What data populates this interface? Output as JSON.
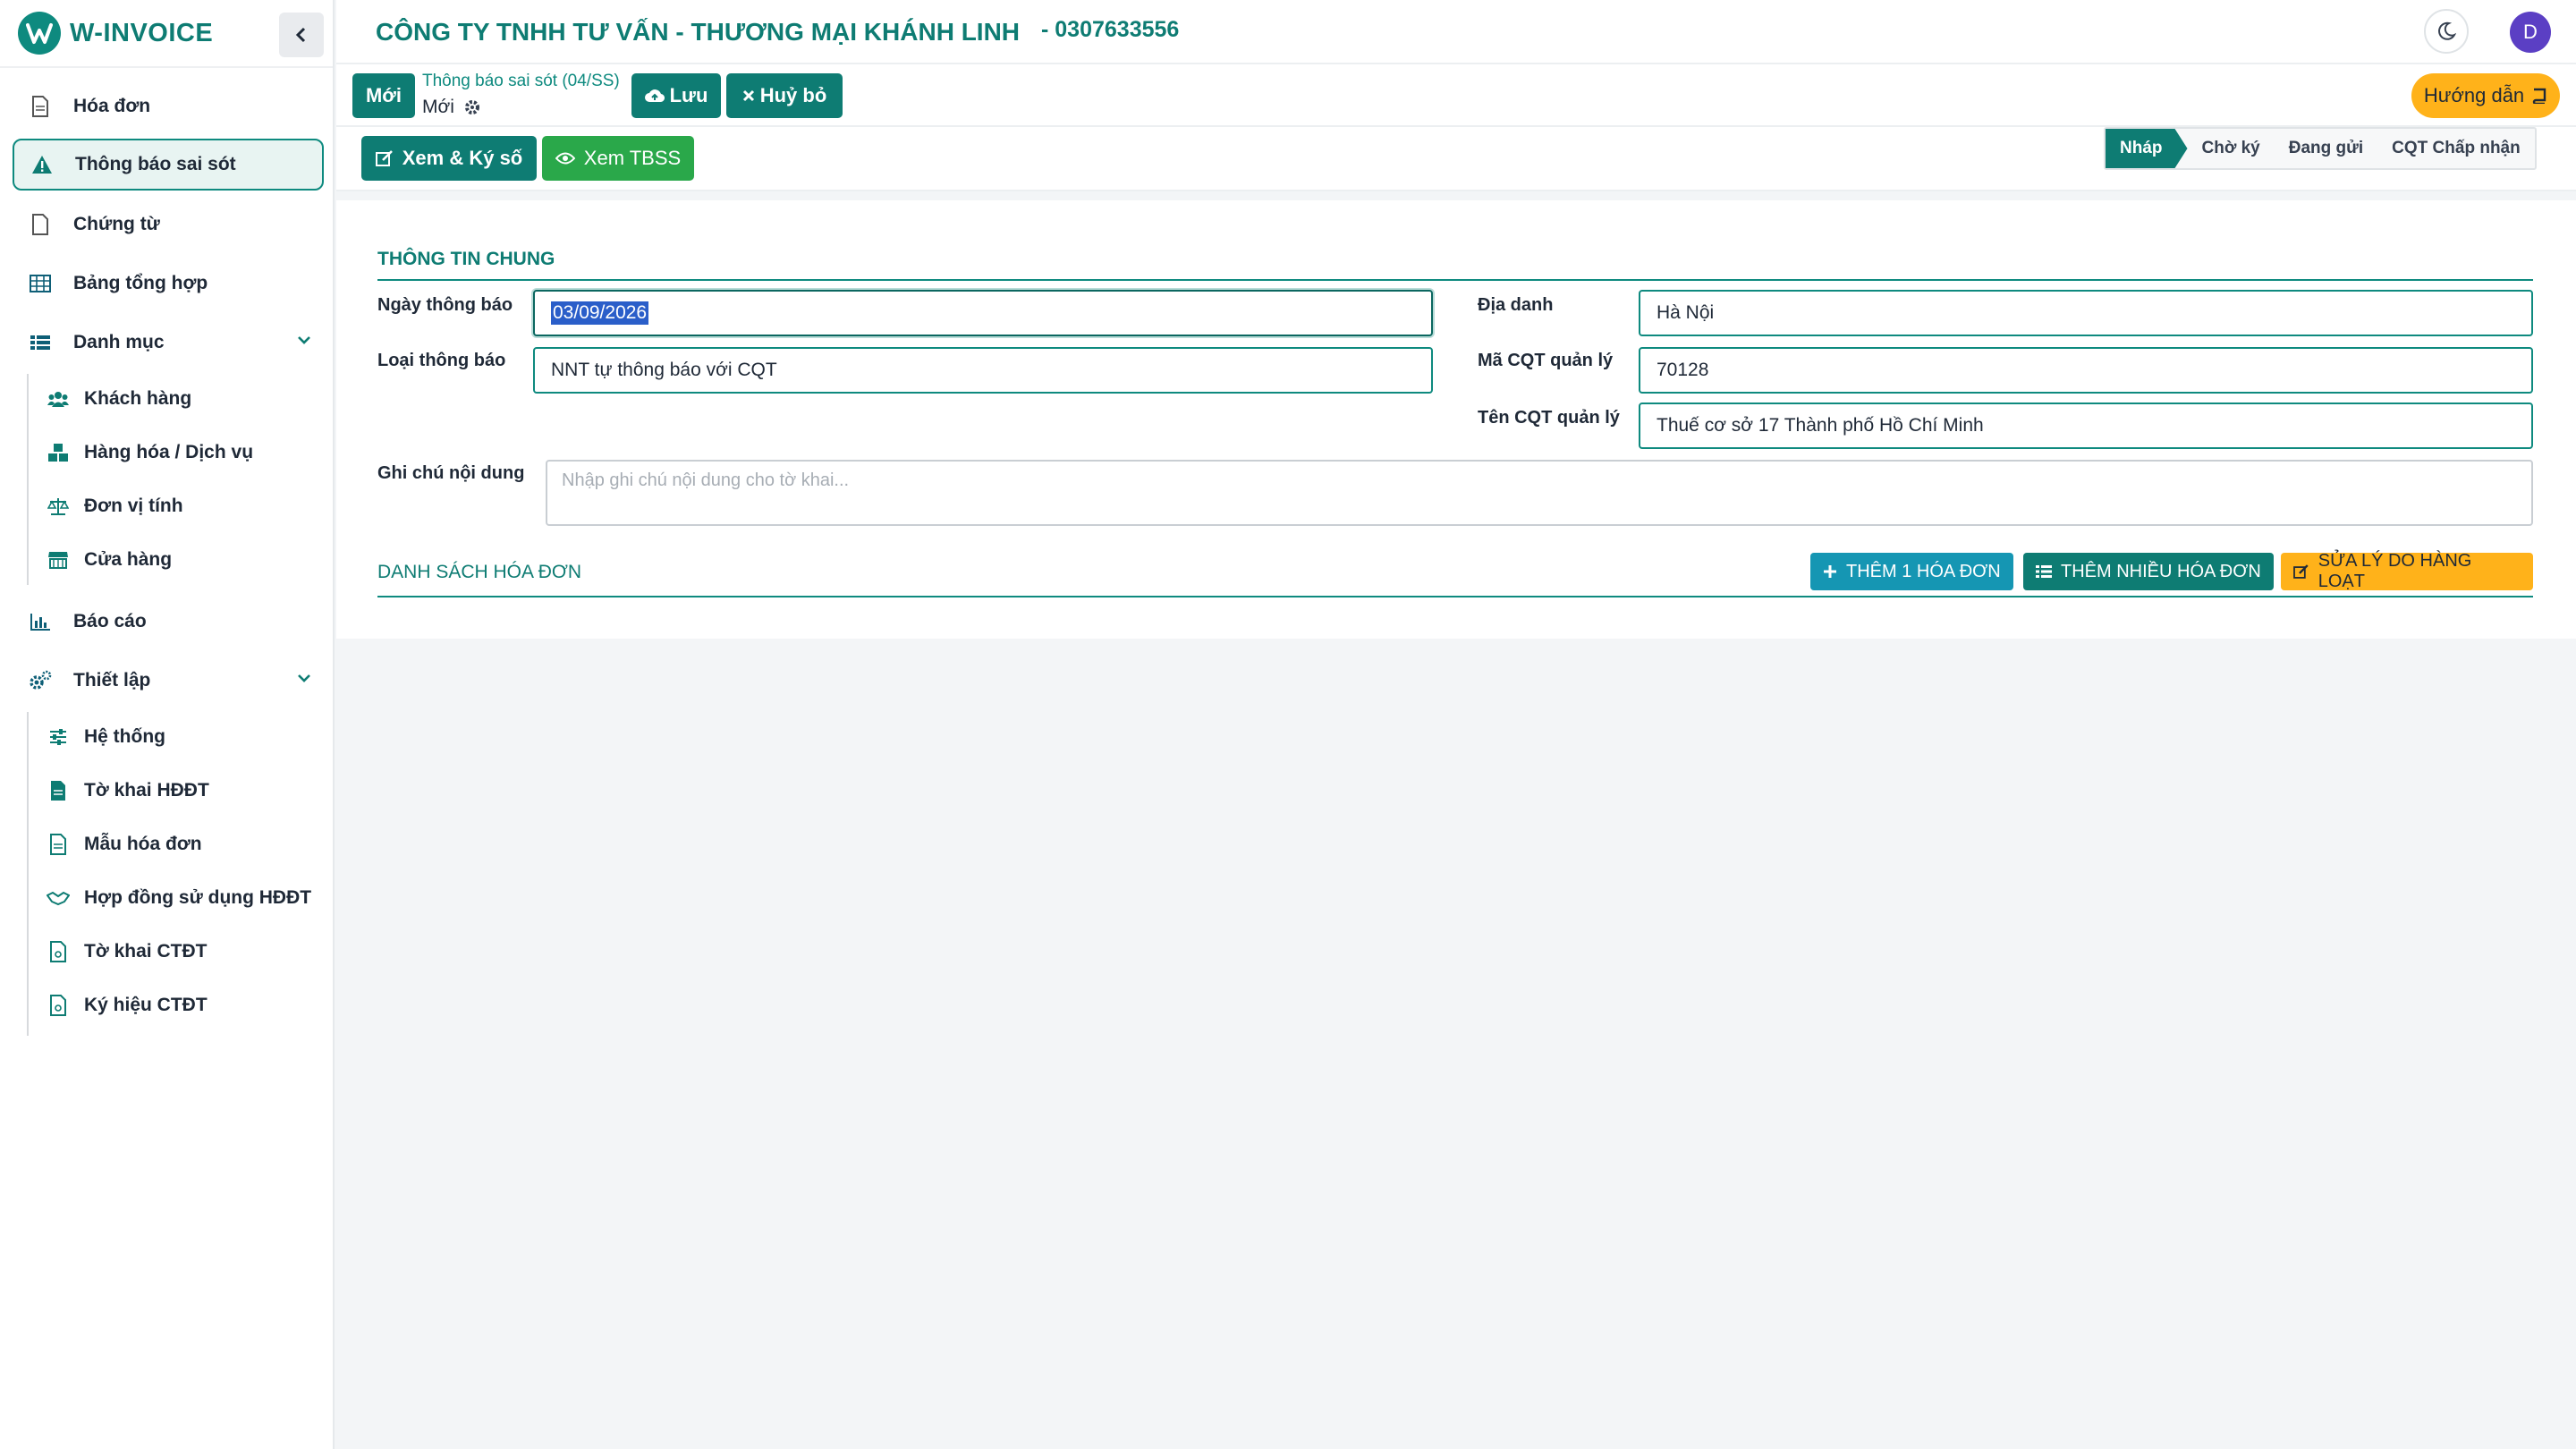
{
  "brand": {
    "name": "W-INVOICE"
  },
  "sidebar": {
    "items": [
      {
        "label": "Hóa đơn",
        "icon": "file-icon"
      },
      {
        "label": "Thông báo sai sót",
        "icon": "warning-icon"
      },
      {
        "label": "Chứng từ",
        "icon": "file-icon"
      },
      {
        "label": "Bảng tổng hợp",
        "icon": "table-icon"
      },
      {
        "label": "Danh mục",
        "icon": "list-icon"
      },
      {
        "label": "Báo cáo",
        "icon": "chart-icon"
      },
      {
        "label": "Thiết lập",
        "icon": "gears-icon"
      }
    ],
    "danh_muc_sub": [
      {
        "label": "Khách hàng",
        "icon": "users-icon"
      },
      {
        "label": "Hàng hóa / Dịch vụ",
        "icon": "cubes-icon"
      },
      {
        "label": "Đơn vị tính",
        "icon": "scale-icon"
      },
      {
        "label": "Cửa hàng",
        "icon": "store-icon"
      }
    ],
    "thiet_lap_sub": [
      {
        "label": "Hệ thống",
        "icon": "sliders-icon"
      },
      {
        "label": "Tờ khai HĐĐT",
        "icon": "document-icon"
      },
      {
        "label": "Mẫu hóa đơn",
        "icon": "file-icon"
      },
      {
        "label": "Hợp đồng sử dụng HĐĐT",
        "icon": "handshake-icon"
      },
      {
        "label": "Tờ khai CTĐT",
        "icon": "file-icon"
      },
      {
        "label": "Ký hiệu CTĐT",
        "icon": "file-icon"
      }
    ]
  },
  "header": {
    "company": "CÔNG TY TNHH TƯ VẤN - THƯƠNG MẠI KHÁNH LINH",
    "tax_code": "- 0307633556",
    "avatar_letter": "D"
  },
  "actionbar": {
    "new_label": "Mới",
    "doc_title": "Thông báo sai sót (04/SS)",
    "doc_state": "Mới",
    "save_label": "Lưu",
    "cancel_label": "Huỷ bỏ",
    "guide_label": "Hướng dẫn"
  },
  "toolbar": {
    "view_sign_label": "Xem & Ký số",
    "view_tbss_label": "Xem TBSS"
  },
  "steps": [
    "Nháp",
    "Chờ ký",
    "Đang gửi",
    "CQT Chấp nhận"
  ],
  "form": {
    "section_general": "THÔNG TIN CHUNG",
    "date_label": "Ngày thông báo",
    "date_value": "03/09/2026",
    "type_label": "Loại thông báo",
    "type_value": "NNT tự thông báo với CQT",
    "place_label": "Địa danh",
    "place_value": "Hà Nội",
    "tax_office_code_label": "Mã CQT quản lý",
    "tax_office_code_value": "70128",
    "tax_office_name_label": "Tên CQT quản lý",
    "tax_office_name_value": "Thuế cơ sở 17 Thành phố Hồ Chí Minh",
    "note_label": "Ghi chú nội dung",
    "note_placeholder": "Nhập ghi chú nội dung cho tờ khai...",
    "section_invoices": "DANH SÁCH HÓA ĐƠN",
    "add_one_label": "THÊM 1 HÓA ĐƠN",
    "add_many_label": "THÊM NHIỀU HÓA ĐƠN",
    "bulk_edit_label": "SỬA LÝ DO HÀNG LOẠT"
  },
  "colors": {
    "brand_teal": "#0e7c73",
    "green": "#2aa84a",
    "orange": "#ffb21a",
    "info": "#1596b3"
  }
}
